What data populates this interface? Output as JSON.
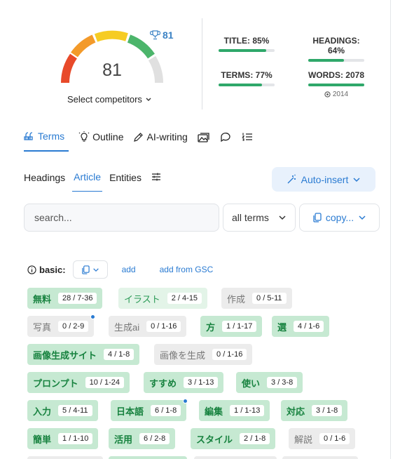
{
  "score": {
    "value": "81",
    "competitor_score": "81",
    "select_competitors": "Select competitors"
  },
  "metrics": {
    "title": {
      "label": "TITLE: 85%",
      "fill": 0.85
    },
    "headings": {
      "label": "HEADINGS: 64%",
      "fill": 0.64
    },
    "terms": {
      "label": "TERMS: 77%",
      "fill": 0.77
    },
    "words": {
      "label": "WORDS: 2078",
      "sub": "2014",
      "fill": 1.0
    }
  },
  "tabs": {
    "terms": "Terms",
    "outline": "Outline",
    "ai_writing": "AI-writing"
  },
  "subtabs": {
    "headings": "Headings",
    "article": "Article",
    "entities": "Entities"
  },
  "auto_insert": "Auto-insert",
  "search": {
    "placeholder": "search..."
  },
  "filter": {
    "value": "all terms"
  },
  "copy": "copy...",
  "basic": {
    "label": "basic:",
    "add": "add",
    "add_gsc": "add from GSC"
  },
  "chips": [
    {
      "term": "無料",
      "count": "28 / 7-36"
    },
    {
      "term": "イラスト",
      "count": "2 / 4-15"
    },
    {
      "term": "作成",
      "count": "0 / 5-11"
    },
    {
      "term": "写真",
      "count": "0 / 2-9"
    },
    {
      "term": "生成ai",
      "count": "0 / 1-16"
    },
    {
      "term": "方",
      "count": "1 / 1-17"
    },
    {
      "term": "選",
      "count": "4 / 1-6"
    },
    {
      "term": "画像生成サイト",
      "count": "4 / 1-8"
    },
    {
      "term": "画像を生成",
      "count": "0 / 1-16"
    },
    {
      "term": "プロンプト",
      "count": "10 / 1-24"
    },
    {
      "term": "すすめ",
      "count": "3 / 1-13"
    },
    {
      "term": "使い",
      "count": "3 / 3-8"
    },
    {
      "term": "入力",
      "count": "5 / 4-11"
    },
    {
      "term": "日本語",
      "count": "6 / 1-8"
    },
    {
      "term": "編集",
      "count": "1 / 1-13"
    },
    {
      "term": "対応",
      "count": "3 / 1-8"
    },
    {
      "term": "簡単",
      "count": "1 / 1-10"
    },
    {
      "term": "活用",
      "count": "6 / 2-8"
    },
    {
      "term": "スタイル",
      "count": "2 / 1-8"
    },
    {
      "term": "解説",
      "count": "0 / 1-6"
    }
  ],
  "colors": {
    "accent": "#2a7bd2",
    "green": "#2fa86a",
    "chip_green": "#c6e9d2",
    "chip_gray": "#ececec"
  }
}
